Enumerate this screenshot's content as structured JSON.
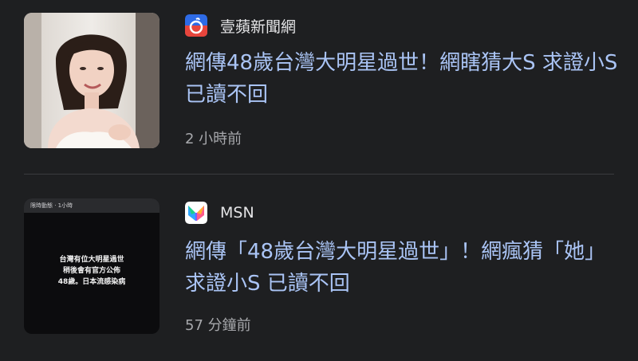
{
  "feed": {
    "items": [
      {
        "source_name": "壹蘋新聞網",
        "source_icon": "apple-daily-logo-icon",
        "headline": "網傳48歲台灣大明星過世！網瞎猜大S 求證小S已讀不回",
        "time": "2 小時前",
        "thumbnail": "woman-portrait-photo"
      },
      {
        "source_name": "MSN",
        "source_icon": "msn-butterfly-logo-icon",
        "headline": "網傳「48歲台灣大明星過世」！網瘋猜「她」 求證小S 已讀不回",
        "time": "57 分鐘前",
        "thumbnail": "story-screenshot",
        "thumbnail_text": {
          "top_bar": "限時動態 · 1小時",
          "lines": [
            "台灣有位大明星過世",
            "稍後會有官方公佈",
            "48歲。日本流感染病"
          ]
        }
      }
    ]
  },
  "colors": {
    "background": "#1e1f21",
    "headline": "#aac4f5",
    "meta": "#a7a8ac",
    "divider": "#3a3b3e"
  }
}
